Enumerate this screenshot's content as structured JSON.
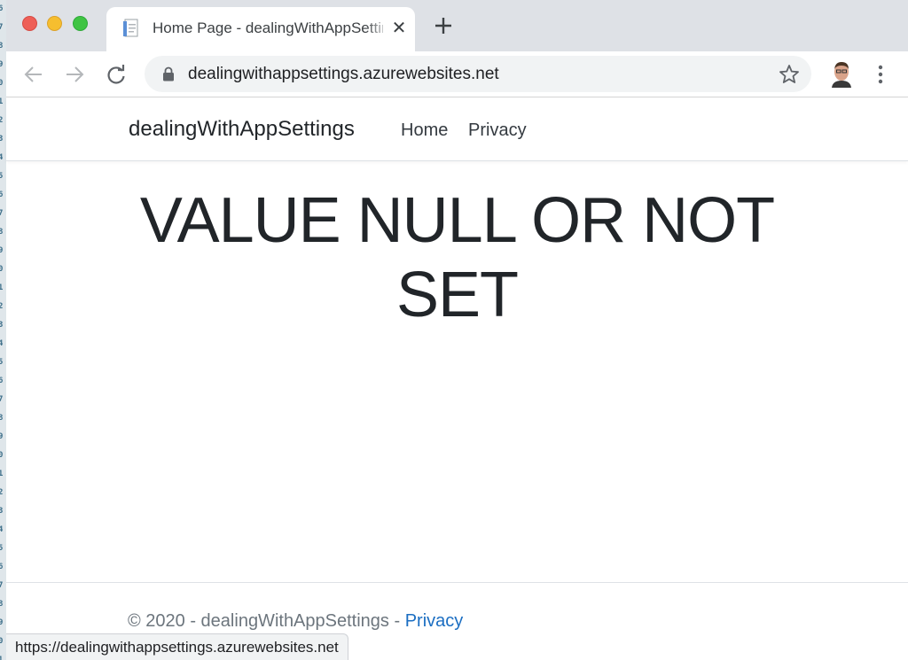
{
  "browser": {
    "tab": {
      "title": "Home Page - dealingWithAppSettings"
    },
    "address_bar": {
      "url": "dealingwithappsettings.azurewebsites.net"
    },
    "status_url": "https://dealingwithappsettings.azurewebsites.net"
  },
  "site": {
    "brand": "dealingWithAppSettings",
    "nav": [
      {
        "label": "Home"
      },
      {
        "label": "Privacy"
      }
    ],
    "headline": "VALUE NULL OR NOT SET",
    "footer": {
      "text": "© 2020 - dealingWithAppSettings - ",
      "link": "Privacy"
    }
  },
  "colors": {
    "link": "#1b6ec2",
    "tab_strip": "#dee1e6",
    "omnibox": "#f1f3f4"
  }
}
